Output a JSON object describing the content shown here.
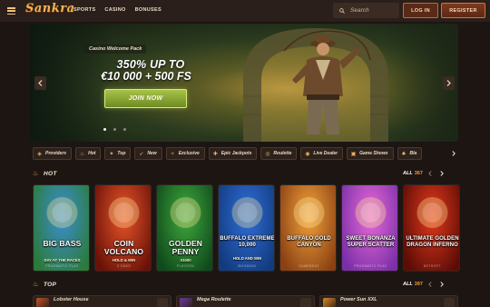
{
  "header": {
    "logo": "Sankra",
    "nav": [
      "SPORTS",
      "CASINO",
      "BONUSES"
    ],
    "search_placeholder": "Search",
    "login_label": "LOG IN",
    "register_label": "REGISTER"
  },
  "banner": {
    "subtitle": "Casino Welcome Pack",
    "headline_line1": "350% UP TO",
    "headline_line2": "€10 000 + 500 FS",
    "cta_label": "JOIN NOW",
    "active_slide": 1,
    "slide_count": 3
  },
  "categories": [
    {
      "label": "Providers",
      "icon": "providers-icon",
      "glyph": "◈"
    },
    {
      "label": "Hot",
      "icon": "fire-icon",
      "glyph": "♨"
    },
    {
      "label": "Top",
      "icon": "thumbs-up-icon",
      "glyph": "✦"
    },
    {
      "label": "New",
      "icon": "rocket-icon",
      "glyph": "➶"
    },
    {
      "label": "Exclusive",
      "icon": "star-icon",
      "glyph": "✧"
    },
    {
      "label": "Epic Jackpots",
      "icon": "jackpot-icon",
      "glyph": "✚"
    },
    {
      "label": "Roulette",
      "icon": "roulette-icon",
      "glyph": "◎"
    },
    {
      "label": "Live Dealer",
      "icon": "live-dealer-icon",
      "glyph": "◉"
    },
    {
      "label": "Game Shows",
      "icon": "game-shows-icon",
      "glyph": "▣"
    },
    {
      "label": "Bla",
      "icon": "blackjack-icon",
      "glyph": "♠"
    }
  ],
  "hot": {
    "title": "HOT",
    "all_label": "ALL",
    "count": "367",
    "games": [
      {
        "title": "BIG BASS",
        "subtitle": "DAY AT THE RACES",
        "provider": "PRAGMATIC PLAY",
        "bg1": "#3a8fd0",
        "bg2": "#2c7a3a"
      },
      {
        "title": "COIN VOLCANO",
        "subtitle": "HOLD & WIN",
        "provider": "3 OAKS",
        "bg1": "#e8542a",
        "bg2": "#6a1208"
      },
      {
        "title": "GOLDEN PENNY",
        "subtitle": "X1000",
        "provider": "PLAYSON",
        "bg1": "#3fa83c",
        "bg2": "#0f4a1c"
      },
      {
        "title": "BUFFALO EXTREME 10,000",
        "subtitle": "HOLD AND WIN",
        "provider": "BOOMING",
        "bg1": "#2f6fd8",
        "bg2": "#123a7e"
      },
      {
        "title": "BUFFALO GOLD CANYON",
        "subtitle": "",
        "provider": "GAMEBEAT",
        "bg1": "#f2a23c",
        "bg2": "#8a4012"
      },
      {
        "title": "SWEET BONANZA SUPER SCATTER",
        "subtitle": "",
        "provider": "PRAGMATIC PLAY",
        "bg1": "#e86ad8",
        "bg2": "#7a2fa8"
      },
      {
        "title": "ULTIMATE GOLDEN DRAGON INFERNO",
        "subtitle": "",
        "provider": "BETSOFT",
        "bg1": "#e2391c",
        "bg2": "#5c0c06"
      }
    ]
  },
  "top": {
    "title": "TOP",
    "all_label": "ALL",
    "count": "397",
    "games": [
      {
        "name": "Lobster House",
        "color": "#c0532b"
      },
      {
        "name": "Mega Roulette",
        "color": "#6a3c9c"
      },
      {
        "name": "Power Sun XXL",
        "color": "#d98a2a"
      }
    ]
  },
  "colors": {
    "accent": "#f29b3a",
    "background": "#1c1512",
    "header": "#2a1f1a",
    "cta": "#8aa82e"
  }
}
